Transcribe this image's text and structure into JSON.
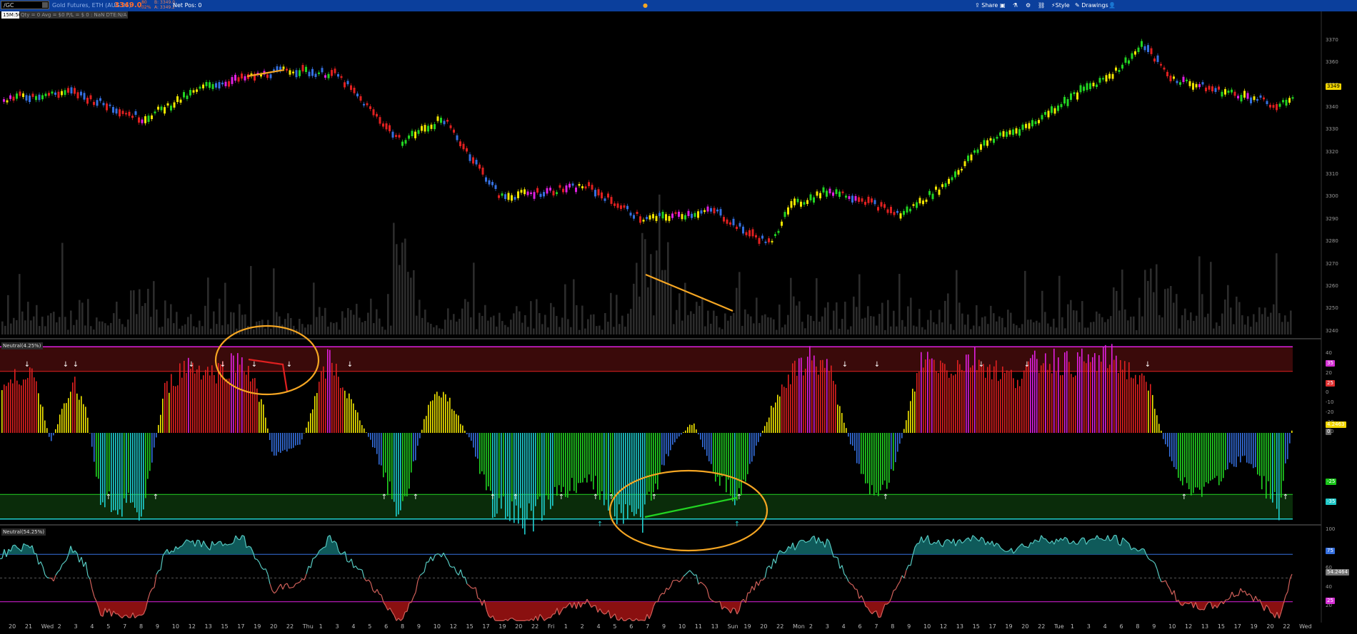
{
  "topbar": {
    "symbol": "/GC",
    "description": "Gold Futures, ETH (AUG 25)",
    "price": "3349.0",
    "change": "-.80",
    "change_pct": "-.02%",
    "bid": "B: 3349.0",
    "ask": "A: 3349.2",
    "net_pos": "Net Pos: 0",
    "buttons": {
      "share": "Share",
      "style": "Style",
      "drawings": "Drawings"
    }
  },
  "chart_header": {
    "timeframe": "15M:50",
    "position_info": "Qty = 0  Avg = $0  P/L = $ 0  : NaN  DTE:N/A"
  },
  "price_axis": {
    "ticks": [
      "3370",
      "3360",
      "3350",
      "3340",
      "3330",
      "3320",
      "3310",
      "3300",
      "3290",
      "3280",
      "3270",
      "3260",
      "3250",
      "3240"
    ],
    "last_price_tag": "3349",
    "last_price_color": "#f2d600"
  },
  "osc1": {
    "title": "Neutral(4.25%)",
    "ticks": [
      "40",
      "30",
      "20",
      "10",
      "0",
      "-10",
      "-20",
      "-30",
      "-40"
    ],
    "tags": [
      {
        "text": "35",
        "bg": "#d42fd4"
      },
      {
        "text": "25",
        "bg": "#e03030"
      },
      {
        "text": "4.2463",
        "bg": "#f2d600"
      },
      {
        "text": "0",
        "bg": "#666"
      },
      {
        "text": "-25",
        "bg": "#19c419"
      },
      {
        "text": "-35",
        "bg": "#1fc8c8"
      }
    ]
  },
  "osc2": {
    "title": "Neutral(54.25%)",
    "ticks": [
      "100",
      "60",
      "40",
      "20"
    ],
    "tags": [
      {
        "text": "75",
        "bg": "#3570e0"
      },
      {
        "text": "54.2464",
        "bg": "#777"
      },
      {
        "text": "25",
        "bg": "#d42fd4"
      }
    ]
  },
  "time_axis": {
    "labels": [
      "20",
      "21",
      "Wed",
      "2",
      "3",
      "4",
      "5",
      "7",
      "8",
      "9",
      "10",
      "12",
      "13",
      "15",
      "17",
      "19",
      "20",
      "22",
      "Thu",
      "1",
      "3",
      "4",
      "5",
      "6",
      "8",
      "9",
      "10",
      "12",
      "15",
      "17",
      "19",
      "20",
      "22",
      "Fri",
      "1",
      "2",
      "4",
      "5",
      "6",
      "7",
      "9",
      "10",
      "11",
      "13",
      "Sun",
      "19",
      "20",
      "22",
      "Mon",
      "2",
      "3",
      "4",
      "6",
      "7",
      "8",
      "9",
      "10",
      "12",
      "13",
      "15",
      "17",
      "19",
      "20",
      "22",
      "Tue",
      "1",
      "3",
      "4",
      "6",
      "8",
      "9",
      "10",
      "12",
      "13",
      "15",
      "17",
      "19",
      "20",
      "22",
      "Wed"
    ]
  },
  "colors": {
    "topbar": "#0b3f9c",
    "bull_strong": "#22d422",
    "bear_strong": "#e02020",
    "neutral": "#f2e600",
    "magenta": "#e020e0",
    "blue": "#3570e0",
    "cyan": "#1fd0d0",
    "annotation": "#f5a623"
  }
}
